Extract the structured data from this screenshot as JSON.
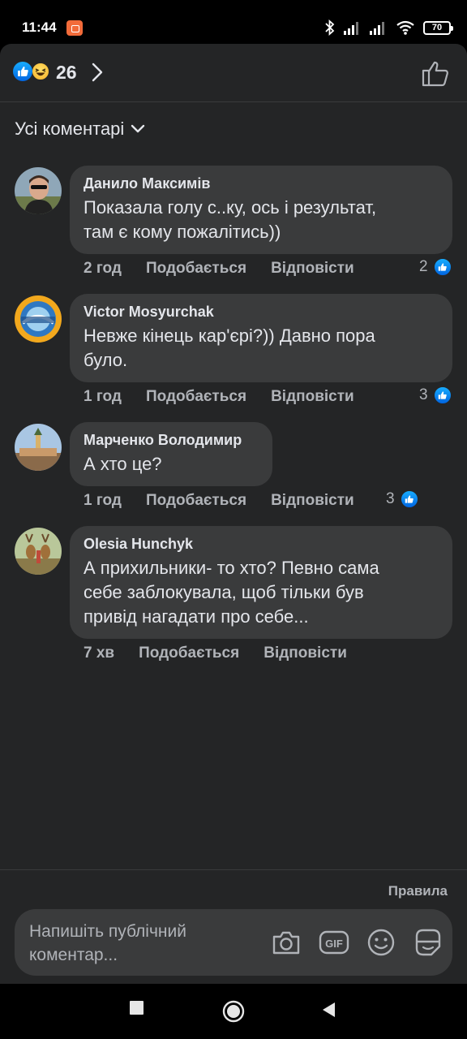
{
  "status_bar": {
    "time": "11:44",
    "battery": "70"
  },
  "reactions": {
    "count": "26",
    "types": [
      "like-icon",
      "haha-icon"
    ]
  },
  "filter": {
    "label": "Усі коментарі"
  },
  "comments": [
    {
      "author": "Данило Максимів",
      "text": "Показала голу с..ку, ось і результат,\nтам є кому пожалітись))",
      "time": "2 год",
      "like_label": "Подобається",
      "reply_label": "Відповісти",
      "reactions": "2"
    },
    {
      "author": "Victor Mosyurchak",
      "text": "Невже кінець кар'єрі?)) Давно пора\nбуло.",
      "time": "1 год",
      "like_label": "Подобається",
      "reply_label": "Відповісти",
      "reactions": "3"
    },
    {
      "author": "Марченко Володимир",
      "text": "А хто це?",
      "time": "1 год",
      "like_label": "Подобається",
      "reply_label": "Відповісти",
      "reactions": "3"
    },
    {
      "author": "Olesia Hunchyk",
      "text": "А прихильники- то хто? Певно сама\nсебе заблокувала, щоб тільки був\nпривід нагадати про себе...",
      "time": "7 хв",
      "like_label": "Подобається",
      "reply_label": "Відповісти",
      "reactions": ""
    }
  ],
  "composer": {
    "rules_label": "Правила",
    "placeholder": "Напишіть публічний коментар..."
  },
  "colors": {
    "sheet_bg": "#242526",
    "bubble_bg": "#3a3b3c",
    "text_primary": "#e4e6eb",
    "text_secondary": "#b0b3b8",
    "like_blue": "#1877f2"
  }
}
